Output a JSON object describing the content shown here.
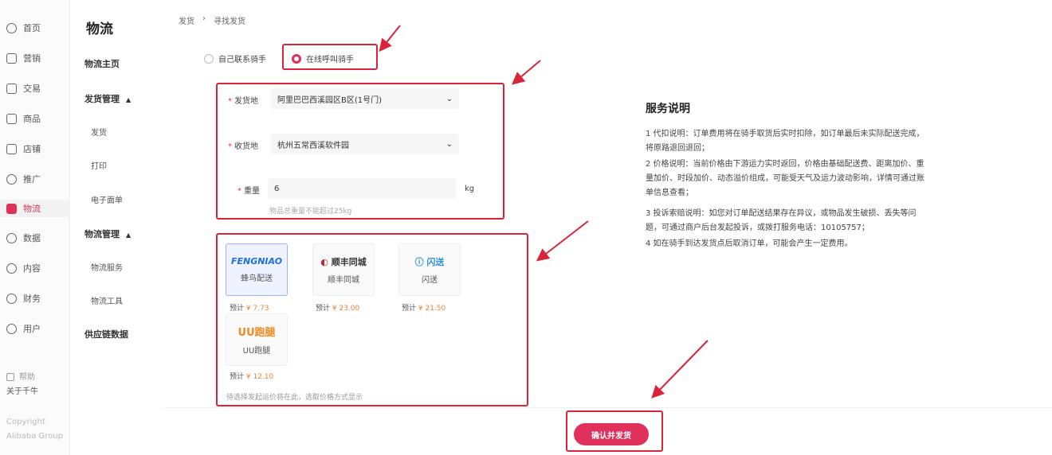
{
  "nav1": {
    "items": [
      {
        "label": "首页",
        "icon": "home-icon"
      },
      {
        "label": "营销",
        "icon": "chat-icon"
      },
      {
        "label": "交易",
        "icon": "order-icon"
      },
      {
        "label": "商品",
        "icon": "goods-icon"
      },
      {
        "label": "店铺",
        "icon": "store-icon"
      },
      {
        "label": "推广",
        "icon": "promo-icon"
      },
      {
        "label": "物流",
        "icon": "truck-icon"
      },
      {
        "label": "数据",
        "icon": "data-icon"
      },
      {
        "label": "内容",
        "icon": "content-icon"
      },
      {
        "label": "财务",
        "icon": "finance-icon"
      },
      {
        "label": "用户",
        "icon": "user-icon"
      }
    ],
    "help_label": "帮助",
    "about_label": "关于千牛",
    "copyright_line1": "Copyright",
    "copyright_line2": "Alibaba Group"
  },
  "nav2": {
    "title": "物流",
    "home": "物流主页",
    "shipping_group": "发货管理",
    "ship": "发货",
    "print": "打印",
    "e_sheet": "电子面单",
    "logistics_group": "物流管理",
    "logistics_service": "物流服务",
    "logistics_tools": "物流工具",
    "supply_chain": "供应链数据"
  },
  "breadcrumb": {
    "root": "发货",
    "sep": "›",
    "current": "寻找发货"
  },
  "mode": {
    "self": "自己联系骑手",
    "online": "在线呼叫骑手"
  },
  "form": {
    "from_label": "发货地",
    "from_value": "阿里巴巴西溪园区B区(1号门)",
    "to_label": "收货地",
    "to_value": "杭州五常西溪软件园",
    "weight_label": "重量",
    "weight_value": "6",
    "weight_unit": "kg",
    "weight_hint": "物品总重量不能超过25kg"
  },
  "couriers": [
    {
      "logo": "FENGNIAO",
      "name": "蜂鸟配送",
      "price_label": "预计",
      "price": "¥ 7.73",
      "color": "#1e6fd9"
    },
    {
      "logo": "顺丰同城",
      "name": "顺丰同城",
      "price_label": "预计",
      "price": "¥ 23.00",
      "color": "#333333"
    },
    {
      "logo": "闪送",
      "name": "闪送",
      "price_label": "预计",
      "price": "¥ 21.50",
      "color": "#2b8fd6"
    },
    {
      "logo": "UU跑腿",
      "name": "UU跑腿",
      "price_label": "预计",
      "price": "¥ 12.10",
      "color": "#f08a24"
    }
  ],
  "courier_note": "待选择发起运价将在此，选取价格方式显示",
  "service": {
    "title": "服务说明",
    "line1": "1 代扣说明：订单费用将在骑手取货后实时扣除，如订单最后未实际配送完成，",
    "line2": "将原路退回退回；",
    "line3": "2 价格说明：当前价格由下游运力实时返回，价格由基础配送费、距离加价、重",
    "line4": "量加价、时段加价、动态溢价组成，可能受天气及运力波动影响，详情可通过账",
    "line5": "单信息查看；",
    "line6": "3 投诉索赔说明：如您对订单配送结果存在异议，或物品发生破损、丢失等问",
    "line7": "题，可通过商户后台发起投诉，或拨打服务电话：10105757；",
    "line8": "4 如在骑手到达发货点后取消订单，可能会产生一定费用。"
  },
  "confirm_button": "确认并发货",
  "colors": {
    "accent": "#e0315a",
    "annotation": "#d9243a",
    "price": "#e6853a"
  }
}
